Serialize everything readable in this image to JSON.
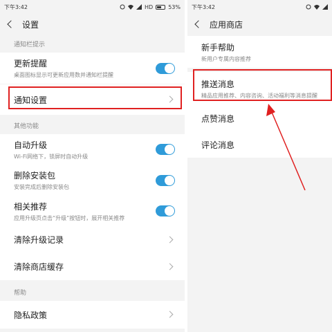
{
  "left": {
    "status": {
      "time": "下午3:42",
      "network": "HD",
      "battery": "53%"
    },
    "title": "设置",
    "sections": {
      "notify": "通知栏提示",
      "other": "其他功能",
      "help": "帮助"
    },
    "items": {
      "update_reminder": {
        "title": "更新提醒",
        "sub": "桌面图标显示可更新应用数并通知栏提醒",
        "enabled": true
      },
      "notify_settings": {
        "title": "通知设置"
      },
      "auto_upgrade": {
        "title": "自动升级",
        "sub": "Wi-Fi网络下，锁屏时自动升级",
        "enabled": true
      },
      "delete_package": {
        "title": "删除安装包",
        "sub": "安装完成后删除安装包",
        "enabled": true
      },
      "related_recommend": {
        "title": "相关推荐",
        "sub": "应用升级页点击“升级”按钮时，展开相关推荐",
        "enabled": true
      },
      "clear_upgrade": {
        "title": "清除升级记录"
      },
      "clear_cache": {
        "title": "清除商店缓存"
      },
      "privacy": {
        "title": "隐私政策"
      }
    }
  },
  "right": {
    "status": {
      "time": "下午3:42"
    },
    "title": "应用商店",
    "items": {
      "newbie": {
        "title": "新手帮助",
        "sub": "新用户专属内容推荐"
      },
      "push": {
        "title": "推送消息",
        "sub": "精品应用推荐、内容咨询、活动福利等消息提醒"
      },
      "likes": {
        "title": "点赞消息"
      },
      "comments": {
        "title": "评论消息"
      }
    }
  },
  "colors": {
    "accent": "#2f9bd9",
    "highlight": "#e02020",
    "background": "#f3f3f3"
  }
}
